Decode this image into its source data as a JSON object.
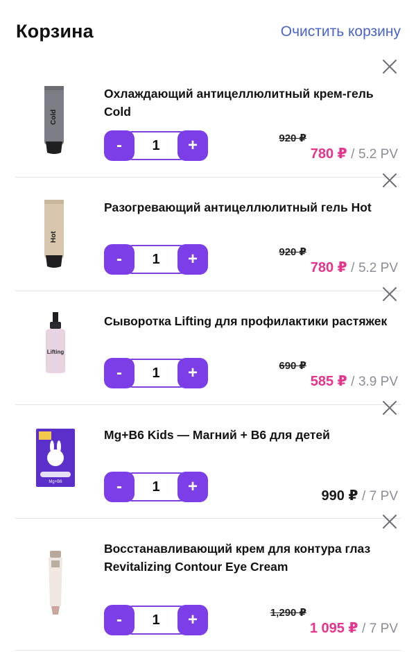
{
  "header": {
    "title": "Корзина",
    "clear_label": "Очистить корзину"
  },
  "items": [
    {
      "name": "Охлаждающий антицеллюлитный крем-гель Cold",
      "qty": "1",
      "minus": "-",
      "plus": "+",
      "old_price": "920 ₽",
      "price": "780 ₽",
      "pv": "5.2 PV",
      "sep": "/",
      "discounted": true,
      "product_label": "Cold"
    },
    {
      "name": "Разогревающий антицеллюлитный гель Hot",
      "qty": "1",
      "minus": "-",
      "plus": "+",
      "old_price": "920 ₽",
      "price": "780 ₽",
      "pv": "5.2 PV",
      "sep": "/",
      "discounted": true,
      "product_label": "Hot"
    },
    {
      "name": "Сыворотка Lifting для профилактики растяжек",
      "qty": "1",
      "minus": "-",
      "plus": "+",
      "old_price": "690 ₽",
      "price": "585 ₽",
      "pv": "3.9 PV",
      "sep": "/",
      "discounted": true,
      "product_label": "Lifting"
    },
    {
      "name": "Mg+B6 Kids — Магний + B6 для детей",
      "qty": "1",
      "minus": "-",
      "plus": "+",
      "old_price": "",
      "price": "990 ₽",
      "pv": "7 PV",
      "sep": "/",
      "discounted": false,
      "product_label": "Mg+B6"
    },
    {
      "name": "Восстанавливающий крем для контура глаз Revitalizing Contour Eye Cream",
      "qty": "1",
      "minus": "-",
      "plus": "+",
      "old_price": "1,290 ₽",
      "price": "1 095 ₽",
      "pv": "7 PV",
      "sep": "/",
      "discounted": true,
      "product_label": ""
    }
  ],
  "colors": {
    "accent": "#7c3ee6",
    "sale": "#e8338c",
    "link": "#4a63c9",
    "muted": "#8a8d96"
  },
  "icons": {
    "close": "close-icon"
  }
}
